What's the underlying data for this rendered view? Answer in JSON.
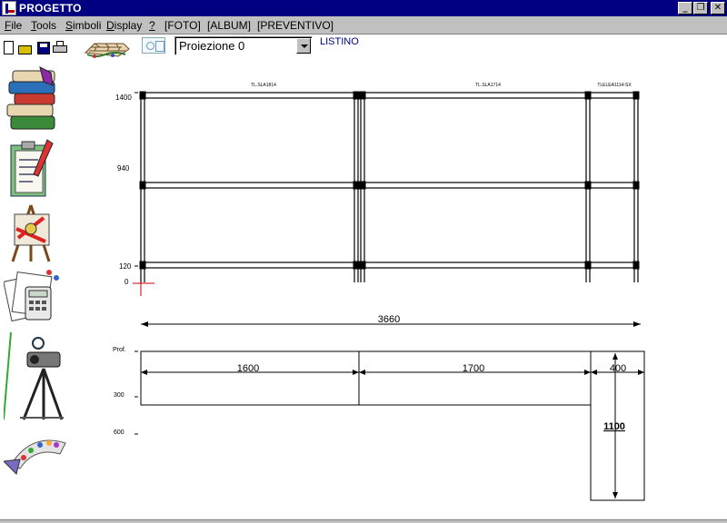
{
  "window": {
    "title": "PROGETTO",
    "min_glyph": "_",
    "restore_glyph": "❐",
    "close_glyph": "✕"
  },
  "menu": {
    "items": [
      {
        "label": "File",
        "underline": "F"
      },
      {
        "label": "Tools",
        "underline": "T"
      },
      {
        "label": "Simboli",
        "underline": "S"
      },
      {
        "label": "Display",
        "underline": "D"
      },
      {
        "label": "?",
        "underline": "?"
      },
      {
        "label": "[FOTO]"
      },
      {
        "label": "[ALBUM]"
      },
      {
        "label": "[PREVENTIVO]"
      }
    ]
  },
  "toolbar": {
    "icons": [
      "new-file-icon",
      "open-folder-icon",
      "save-disk-icon",
      "print-icon",
      "bricks-icon",
      "view-mode-icon"
    ],
    "projection_select": {
      "value": "Proiezione 0"
    },
    "listino_label": "LISTINO"
  },
  "sidebar": {
    "buttons": [
      {
        "name": "books-catalog-button",
        "icon": "books-icon"
      },
      {
        "name": "clipboard-list-button",
        "icon": "clipboard-icon"
      },
      {
        "name": "easel-drawing-button",
        "icon": "easel-icon"
      },
      {
        "name": "calculator-docs-button",
        "icon": "calculator-icon"
      },
      {
        "name": "camera-tripod-button",
        "icon": "camera-tripod-icon"
      },
      {
        "name": "back-arrow-button",
        "icon": "back-arrow-icon"
      }
    ]
  },
  "colors": {
    "titlebar": "#000080",
    "chrome": "#c0c0c0",
    "listino": "#000080",
    "origin_marker": "#cc0000"
  },
  "drawing": {
    "front_view": {
      "level_labels": [
        "1400",
        "940",
        "120",
        "0"
      ],
      "module_codes": [
        "TL.SLA1814",
        "TL.SLA1714",
        "TLELEA1114-SX"
      ],
      "total_width": "3660"
    },
    "plan_view": {
      "depth_labels": [
        "Prof.",
        "300",
        "600"
      ],
      "module_widths": [
        "1600",
        "1700",
        "400"
      ],
      "end_depth": "1100"
    }
  }
}
